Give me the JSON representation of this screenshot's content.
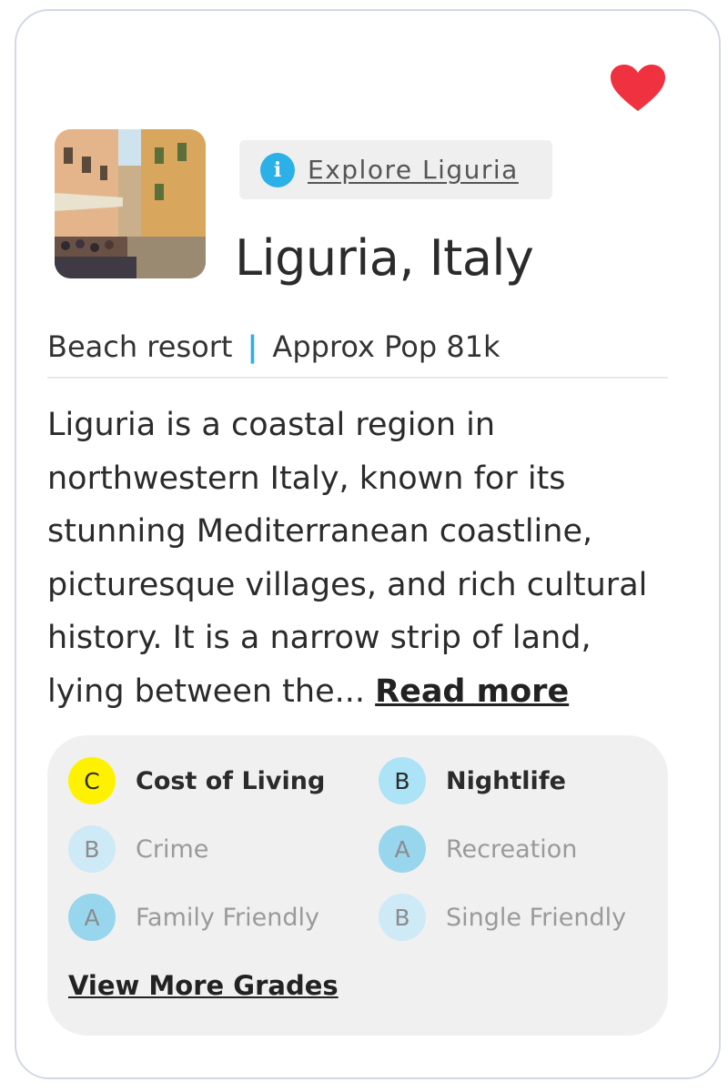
{
  "card": {
    "explore_label": "Explore Liguria",
    "title": "Liguria, Italy",
    "type": "Beach resort",
    "separator": "|",
    "population": "Approx Pop 81k",
    "description": "Liguria is a coastal region in northwestern Italy, known for its stunning Mediterranean coastline, picturesque villages, and rich cultural history. It is a narrow strip of land, lying between the...",
    "read_more": "Read more",
    "favorite_color": "#f0313f"
  },
  "grades": {
    "items": [
      {
        "grade": "C",
        "label": "Cost of Living",
        "color": "#fff200",
        "emphasis": "strong"
      },
      {
        "grade": "B",
        "label": "Nightlife",
        "color": "#ace3f6",
        "emphasis": "strong"
      },
      {
        "grade": "B",
        "label": "Crime",
        "color": "#cdeaf6",
        "emphasis": "faded"
      },
      {
        "grade": "A",
        "label": "Recreation",
        "color": "#98d6ee",
        "emphasis": "faded"
      },
      {
        "grade": "A",
        "label": "Family Friendly",
        "color": "#98d6ee",
        "emphasis": "faded"
      },
      {
        "grade": "B",
        "label": "Single Friendly",
        "color": "#cdeaf6",
        "emphasis": "faded"
      }
    ],
    "view_more": "View More Grades"
  },
  "icons": {
    "favorite": "heart-icon",
    "info": "info-icon"
  }
}
